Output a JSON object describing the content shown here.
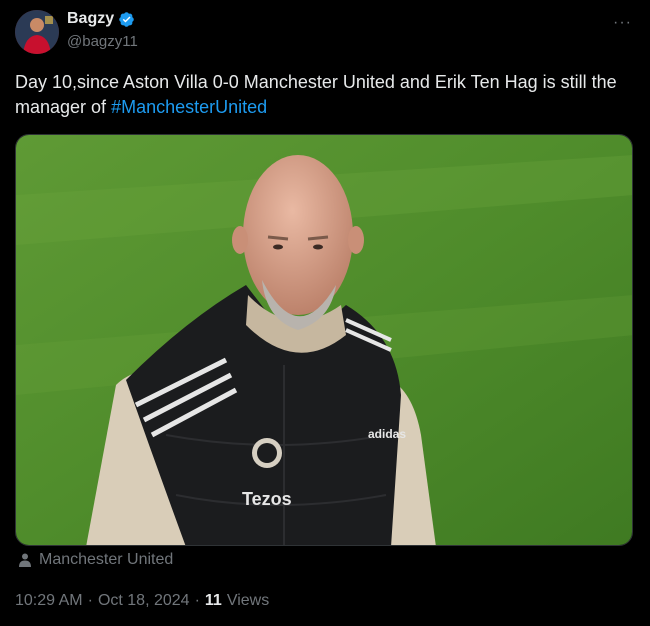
{
  "author": {
    "display_name": "Bagzy",
    "handle": "@bagzy11",
    "verified": true,
    "avatar_icon": "avatar-icon"
  },
  "more_label": "···",
  "tweet": {
    "text": "Day 10,since Aston Villa 0-0 Manchester United and Erik Ten Hag is still the manager of ",
    "hashtag": "#ManchesterUnited"
  },
  "media": {
    "jersey_text": "Tezos",
    "brand_text": "adidas"
  },
  "location": {
    "icon": "person-icon",
    "label": "Manchester United"
  },
  "meta": {
    "time": "10:29 AM",
    "separator": "·",
    "date": "Oct 18, 2024",
    "separator2": "·",
    "views_count": "11",
    "views_label": "Views"
  },
  "colors": {
    "background": "#000000",
    "text": "#e7e9ea",
    "muted": "#71767b",
    "link": "#1d9bf0"
  }
}
